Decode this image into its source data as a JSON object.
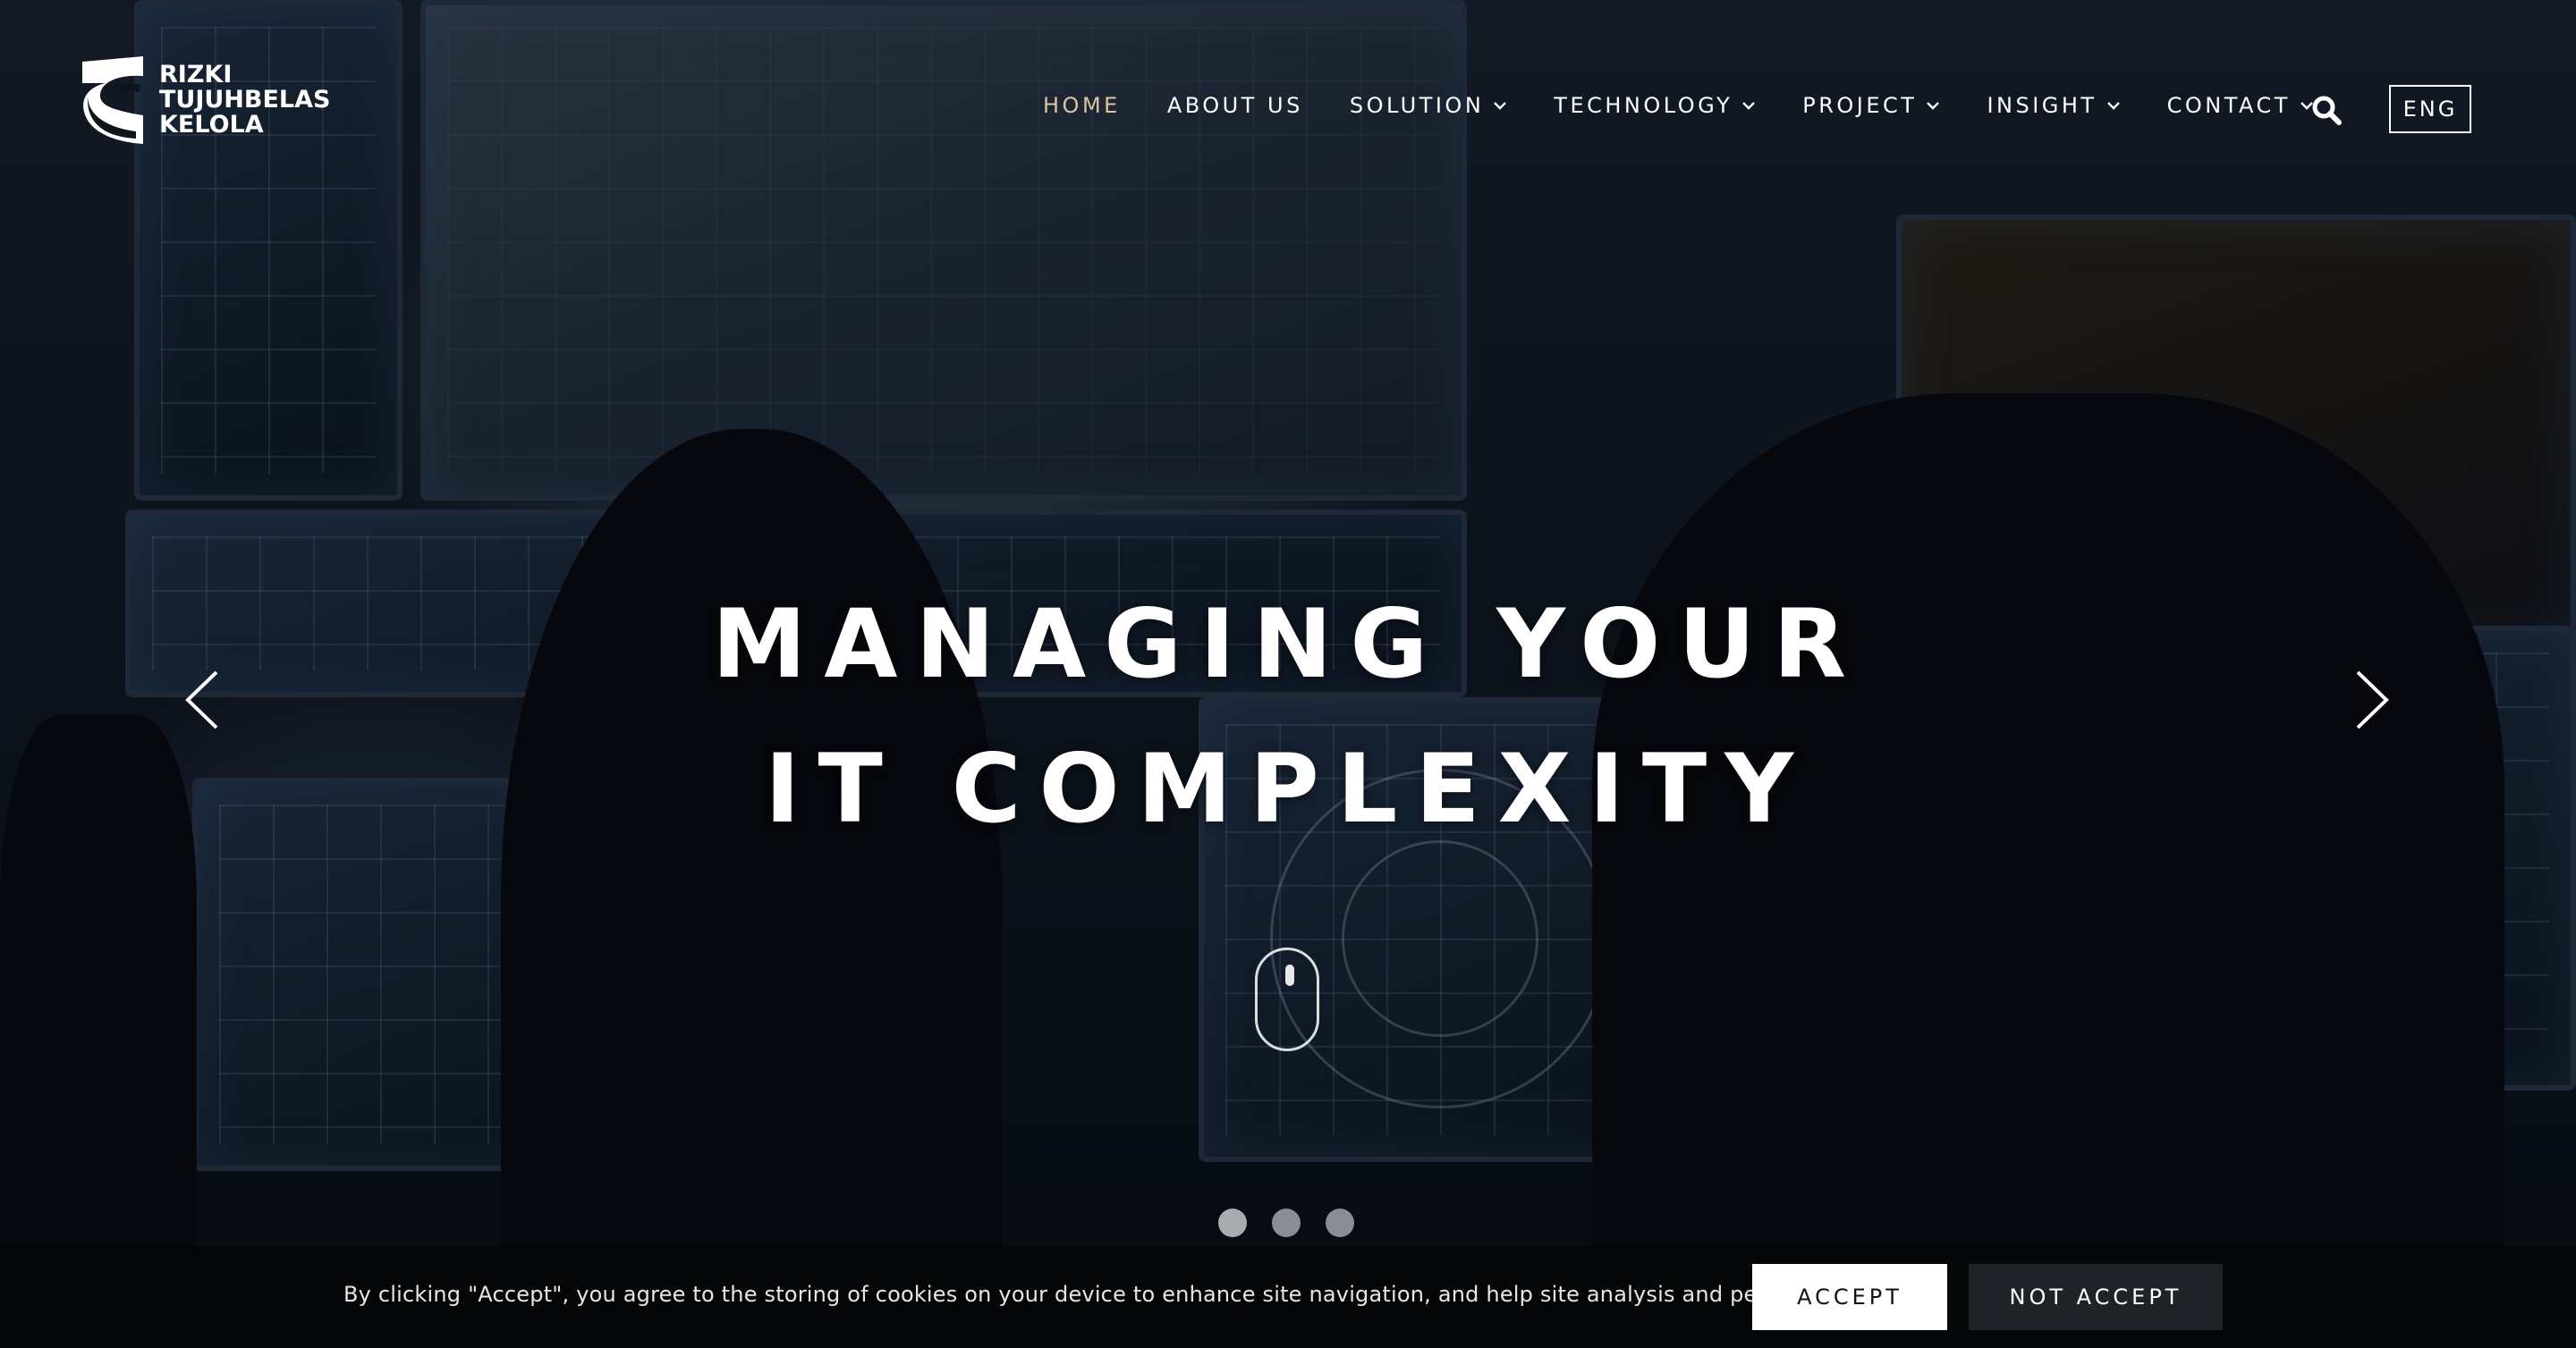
{
  "brand": {
    "logo_lines": [
      "RIZKI",
      "TUJUHBELAS",
      "KELOLA"
    ]
  },
  "nav": {
    "items": [
      {
        "label": "HOME",
        "has_dropdown": false,
        "active": true
      },
      {
        "label": "ABOUT US",
        "has_dropdown": false,
        "active": false
      },
      {
        "label": "SOLUTION",
        "has_dropdown": true,
        "active": false
      },
      {
        "label": "TECHNOLOGY",
        "has_dropdown": true,
        "active": false
      },
      {
        "label": "PROJECT",
        "has_dropdown": true,
        "active": false
      },
      {
        "label": "INSIGHT",
        "has_dropdown": true,
        "active": false
      },
      {
        "label": "CONTACT",
        "has_dropdown": true,
        "active": false
      }
    ],
    "search_icon": "search-icon",
    "language": "ENG"
  },
  "hero": {
    "headline_line1": "MANAGING YOUR",
    "headline_line2": "IT COMPLEXITY",
    "slides_count": 3,
    "active_slide": 1
  },
  "cookie": {
    "message": "By clicking \"Accept\", you agree to the storing of cookies on your device to enhance site navigation, and help site analysis and performance.",
    "accept_label": "ACCEPT",
    "reject_label": "NOT ACCEPT"
  },
  "colors": {
    "active_nav": "#d9c7a3",
    "cookie_bar": "#050607",
    "accept_bg": "#ffffff",
    "reject_bg": "#1f2327"
  }
}
